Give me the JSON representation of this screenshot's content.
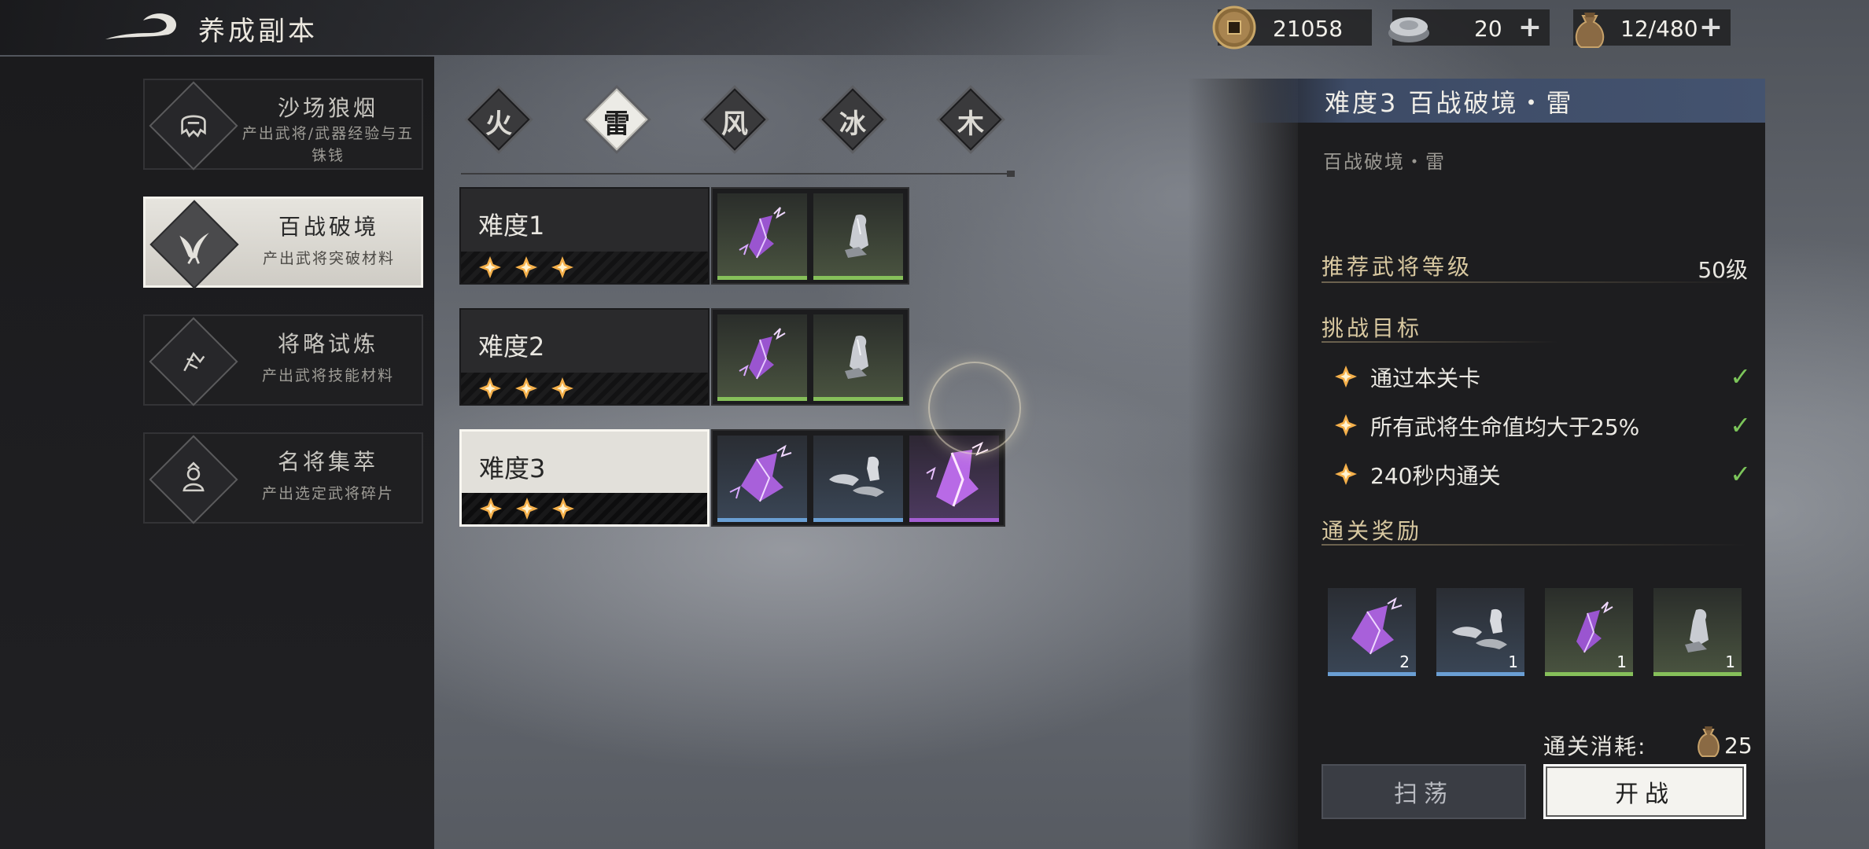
{
  "header": {
    "title": "养成副本",
    "back_icon": "back-arrow-icon"
  },
  "currencies": [
    {
      "name": "coin",
      "icon": "copper-coin-icon",
      "value": "21058",
      "has_plus": false
    },
    {
      "name": "silver",
      "icon": "silver-ingot-icon",
      "value": "20",
      "has_plus": true
    },
    {
      "name": "stamina",
      "icon": "pouch-icon",
      "value": "12/480",
      "has_plus": true
    }
  ],
  "plus_label": "+",
  "sidebar": {
    "items": [
      {
        "title": "沙场狼烟",
        "subtitle": "产出武将/武器经验与五铢钱",
        "icon": "helmet-icon",
        "active": false
      },
      {
        "title": "百战破境",
        "subtitle": "产出武将突破材料",
        "icon": "phoenix-icon",
        "active": true
      },
      {
        "title": "将略试炼",
        "subtitle": "产出武将技能材料",
        "icon": "strategy-icon",
        "active": false
      },
      {
        "title": "名将集萃",
        "subtitle": "产出选定武将碎片",
        "icon": "general-icon",
        "active": false
      }
    ]
  },
  "element_tabs": [
    {
      "label": "火",
      "active": false
    },
    {
      "label": "雷",
      "active": true
    },
    {
      "label": "风",
      "active": false
    },
    {
      "label": "冰",
      "active": false
    },
    {
      "label": "木",
      "active": false
    }
  ],
  "difficulties": [
    {
      "label": "难度1",
      "stars": 3,
      "active": false
    },
    {
      "label": "难度2",
      "stars": 3,
      "active": false
    },
    {
      "label": "难度3",
      "stars": 3,
      "active": true
    }
  ],
  "detail": {
    "header": "难度3  百战破境・雷",
    "subtitle": "百战破境・雷",
    "recommend_label": "推荐武将等级",
    "recommend_value": "50级",
    "objectives_label": "挑战目标",
    "objectives": [
      {
        "text": "通过本关卡",
        "done": true
      },
      {
        "text": "所有武将生命值均大于25%",
        "done": true
      },
      {
        "text": "240秒内通关",
        "done": true
      }
    ],
    "check_mark": "✓",
    "rewards_label": "通关奖励",
    "rewards": [
      {
        "icon": "thunder-crystal-large-icon",
        "count": "2"
      },
      {
        "icon": "silver-fragments-icon",
        "count": "1"
      },
      {
        "icon": "thunder-crystal-icon",
        "count": "1"
      },
      {
        "icon": "silver-ore-icon",
        "count": "1"
      }
    ],
    "cost_label": "通关消耗:",
    "cost_value": "25",
    "sweep_label": "扫荡",
    "fight_label": "开战"
  },
  "colors": {
    "accent_gold": "#d8c8a0",
    "check_green": "#7cc55a",
    "rarity_green": "#86c05a",
    "rarity_blue": "#6a9fd4",
    "rarity_purple": "#a35ed2",
    "header_blue": "#44536f"
  }
}
